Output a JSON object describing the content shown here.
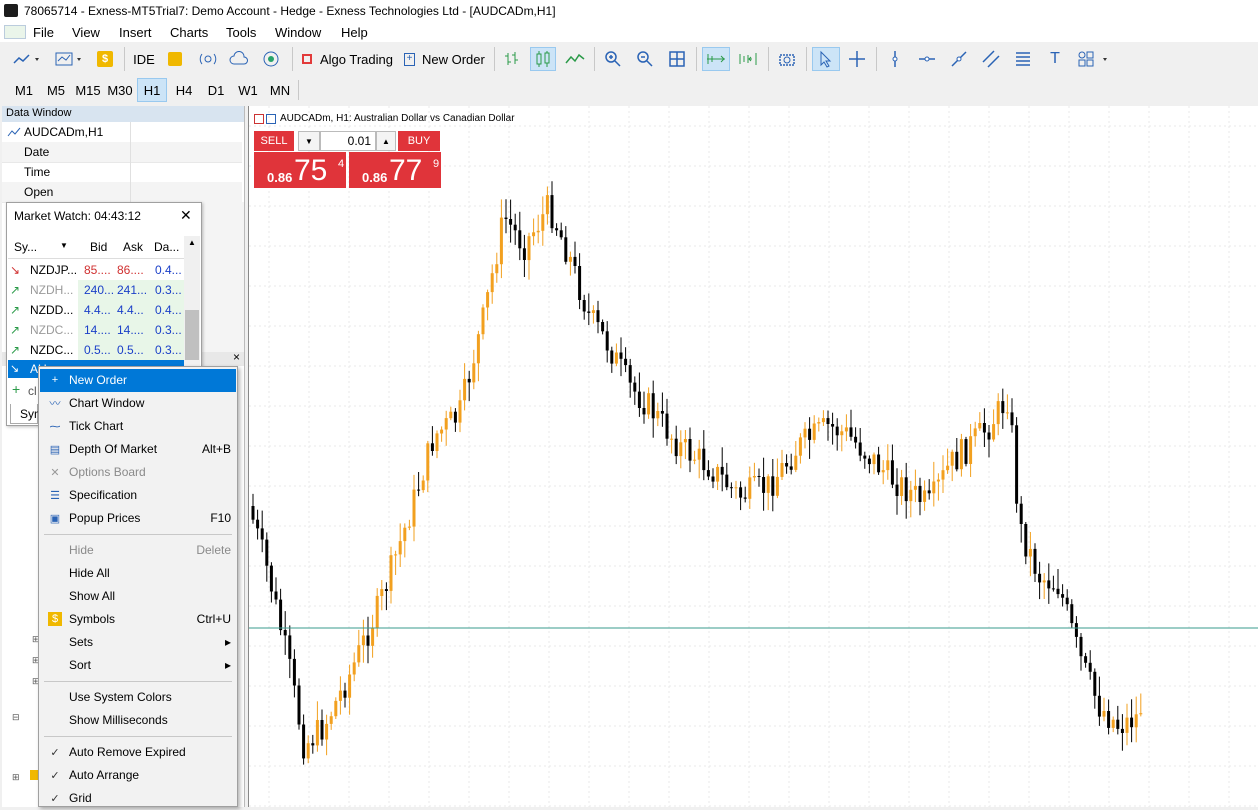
{
  "window": {
    "title": "78065714 - Exness-MT5Trial7: Demo Account - Hedge - Exness Technologies Ltd - [AUDCADm,H1]",
    "icon": "mt5-logo-icon"
  },
  "menu": [
    "File",
    "View",
    "Insert",
    "Charts",
    "Tools",
    "Window",
    "Help"
  ],
  "toolbar": {
    "ide_label": "IDE",
    "algo_trading_label": "Algo Trading",
    "new_order_label": "New Order"
  },
  "timeframes": [
    "M1",
    "M5",
    "M15",
    "M30",
    "H1",
    "H4",
    "D1",
    "W1",
    "MN"
  ],
  "active_timeframe": "H1",
  "data_window": {
    "title": "Data Window",
    "symbol": "AUDCADm,H1",
    "rows": [
      "Date",
      "Time",
      "Open"
    ]
  },
  "chart": {
    "title": "AUDCADm, H1:  Australian Dollar vs Canadian Dollar",
    "sell_label": "SELL",
    "buy_label": "BUY",
    "lot_value": "0.01",
    "sell_price_prefix": "0.86",
    "sell_price_big": "75",
    "sell_price_sup": "4",
    "buy_price_prefix": "0.86",
    "buy_price_big": "77",
    "buy_price_sup": "9",
    "colors": {
      "bull": "#f2a01f",
      "bear": "#000000",
      "bid_line": "#3a9b8e"
    }
  },
  "market_watch": {
    "title": "Market Watch: 04:43:12",
    "headers": [
      "Sy...",
      "Bid",
      "Ask",
      "Da..."
    ],
    "rows": [
      {
        "arrow": "↘",
        "symbol": "NZDJP...",
        "bid": "85....",
        "ask": "86....",
        "daily": "0.4...",
        "style": "down"
      },
      {
        "arrow": "↗",
        "symbol": "NZDH...",
        "bid": "240...",
        "ask": "241...",
        "daily": "0.3...",
        "style": "up-gray"
      },
      {
        "arrow": "↗",
        "symbol": "NZDD...",
        "bid": "4.4...",
        "ask": "4.4...",
        "daily": "0.4...",
        "style": "up"
      },
      {
        "arrow": "↗",
        "symbol": "NZDC...",
        "bid": "14....",
        "ask": "14....",
        "daily": "0.3...",
        "style": "up-gray"
      },
      {
        "arrow": "↗",
        "symbol": "NZDC...",
        "bid": "0.5...",
        "ask": "0.5...",
        "daily": "0.3...",
        "style": "up"
      }
    ],
    "selected_symbol": "AU",
    "add_label": "cl",
    "tab_label": "Sym"
  },
  "context_menu": [
    {
      "label": "New Order",
      "shortcut": "",
      "icon": "new-order-icon",
      "state": "highlighted"
    },
    {
      "label": "Chart Window",
      "shortcut": "",
      "icon": "chart-window-icon",
      "state": "normal"
    },
    {
      "label": "Tick Chart",
      "shortcut": "",
      "icon": "tick-chart-icon",
      "state": "normal"
    },
    {
      "label": "Depth Of Market",
      "shortcut": "Alt+B",
      "icon": "depth-of-market-icon",
      "state": "normal"
    },
    {
      "label": "Options Board",
      "shortcut": "",
      "icon": "options-board-icon",
      "state": "disabled"
    },
    {
      "label": "Specification",
      "shortcut": "",
      "icon": "specification-icon",
      "state": "normal"
    },
    {
      "label": "Popup Prices",
      "shortcut": "F10",
      "icon": "popup-prices-icon",
      "state": "normal"
    },
    {
      "label": "Hide",
      "shortcut": "Delete",
      "icon": "",
      "state": "disabled"
    },
    {
      "label": "Hide All",
      "shortcut": "",
      "icon": "",
      "state": "normal"
    },
    {
      "label": "Show All",
      "shortcut": "",
      "icon": "",
      "state": "normal"
    },
    {
      "label": "Symbols",
      "shortcut": "Ctrl+U",
      "icon": "symbols-icon",
      "state": "normal"
    },
    {
      "label": "Sets",
      "shortcut": "▸",
      "icon": "",
      "state": "normal"
    },
    {
      "label": "Sort",
      "shortcut": "▸",
      "icon": "",
      "state": "normal"
    },
    {
      "label": "Use System Colors",
      "shortcut": "",
      "icon": "",
      "state": "normal"
    },
    {
      "label": "Show Milliseconds",
      "shortcut": "",
      "icon": "",
      "state": "normal"
    },
    {
      "label": "Auto Remove Expired",
      "shortcut": "",
      "icon": "check-icon",
      "state": "checked"
    },
    {
      "label": "Auto Arrange",
      "shortcut": "",
      "icon": "check-icon",
      "state": "checked"
    },
    {
      "label": "Grid",
      "shortcut": "",
      "icon": "check-icon",
      "state": "checked"
    }
  ]
}
